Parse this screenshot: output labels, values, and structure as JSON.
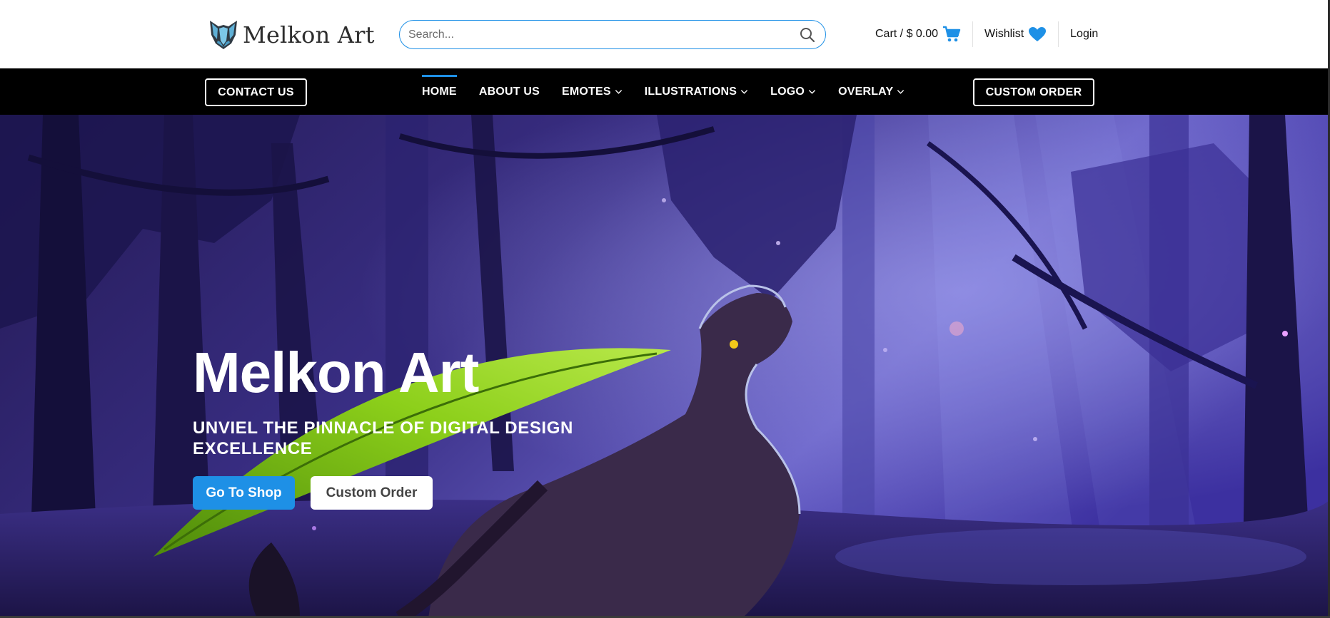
{
  "brand": {
    "name": "Melkon Art",
    "logo_icon": "wolf-mask-icon",
    "accent_color": "#1e90e6"
  },
  "search": {
    "placeholder": "Search...",
    "icon": "search-icon"
  },
  "header_actions": {
    "cart_label": "Cart / $ 0.00",
    "cart_icon": "cart-icon",
    "wishlist_label": "Wishlist",
    "wishlist_icon": "heart-icon",
    "login_label": "Login"
  },
  "nav": {
    "contact_label": "CONTACT US",
    "custom_order_label": "CUSTOM ORDER",
    "items": [
      {
        "label": "HOME",
        "active": true,
        "dropdown": false
      },
      {
        "label": "ABOUT US",
        "active": false,
        "dropdown": false
      },
      {
        "label": "EMOTES",
        "active": false,
        "dropdown": true
      },
      {
        "label": "ILLUSTRATIONS",
        "active": false,
        "dropdown": true
      },
      {
        "label": "LOGO",
        "active": false,
        "dropdown": true
      },
      {
        "label": "OVERLAY",
        "active": false,
        "dropdown": true
      }
    ]
  },
  "hero": {
    "title": "Melkon Art",
    "subtitle": "UNVIEL THE PINNACLE OF DIGITAL DESIGN EXCELLENCE",
    "primary_button": "Go To Shop",
    "secondary_button": "Custom Order"
  }
}
